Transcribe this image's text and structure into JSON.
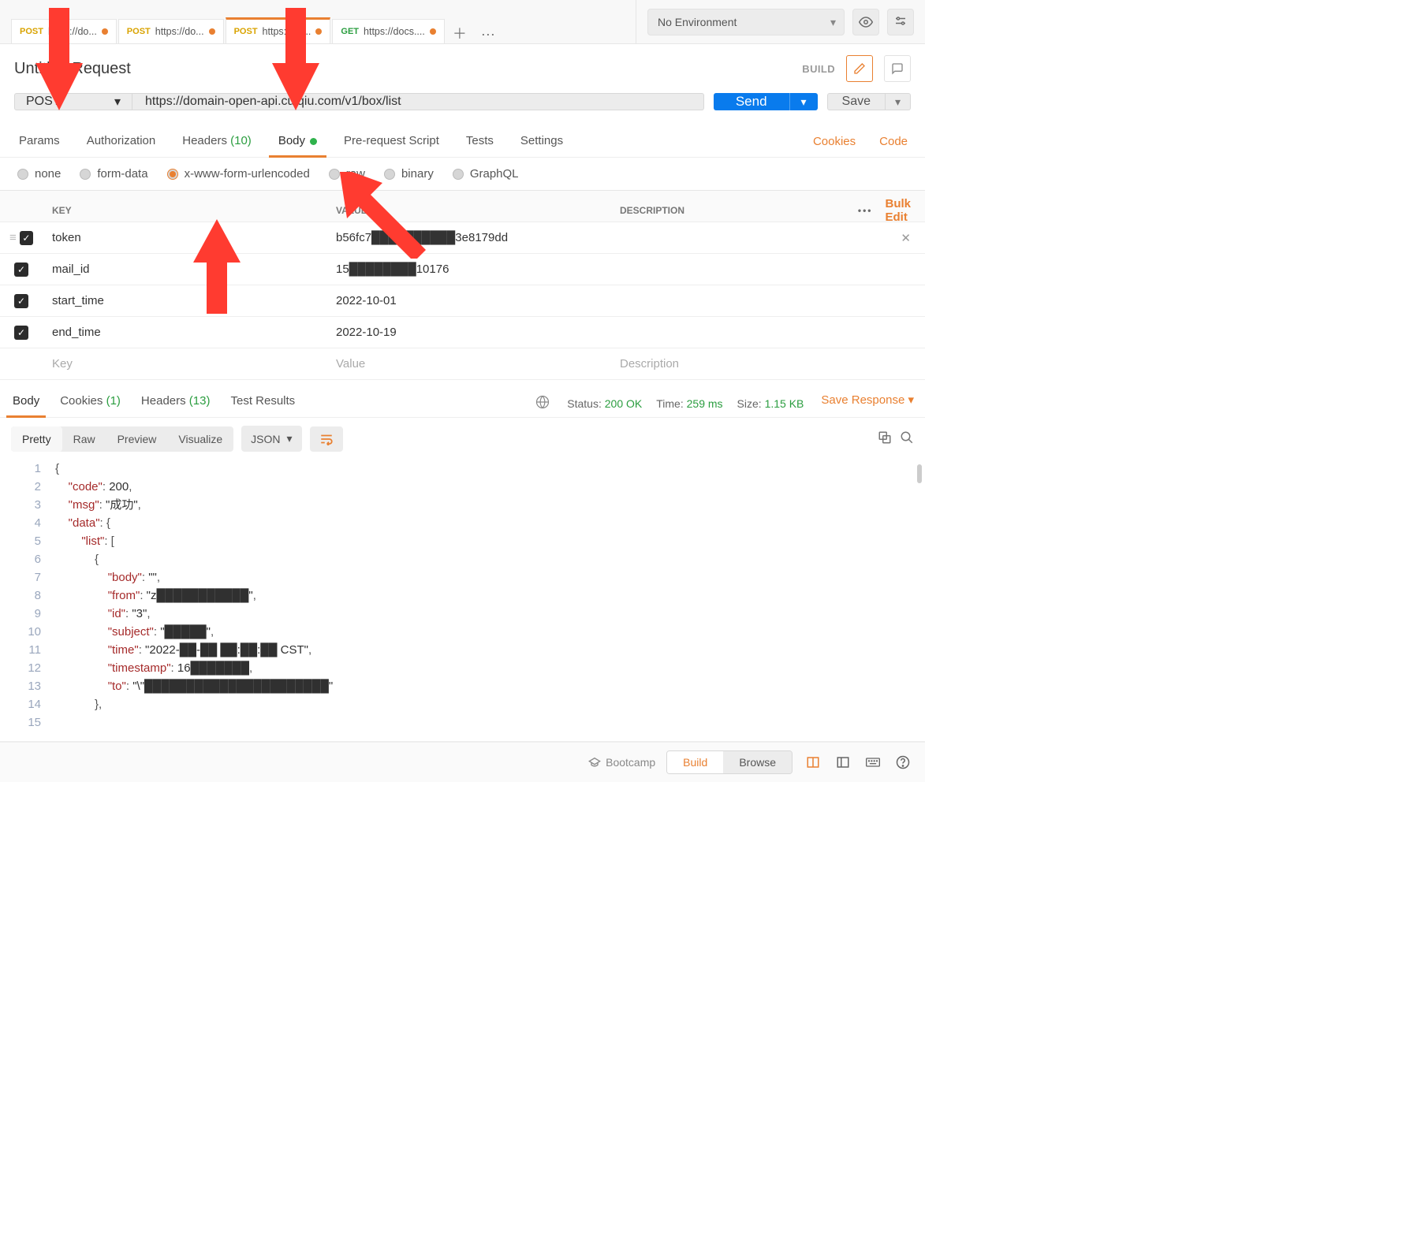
{
  "tabs": [
    {
      "method": "POST",
      "cls": "post",
      "title": "https://do...",
      "active": false
    },
    {
      "method": "POST",
      "cls": "post",
      "title": "https://do...",
      "active": false
    },
    {
      "method": "POST",
      "cls": "post",
      "title": "https://do...",
      "active": true
    },
    {
      "method": "GET",
      "cls": "get",
      "title": "https://docs....",
      "active": false
    }
  ],
  "env": {
    "label": "No Environment"
  },
  "request": {
    "title": "Untitled Request",
    "build_label": "BUILD",
    "method": "POST",
    "url": "https://domain-open-api.cuiqiu.com/v1/box/list",
    "send_label": "Send",
    "save_label": "Save"
  },
  "req_tabs": {
    "params": "Params",
    "auth": "Authorization",
    "headers": "Headers",
    "headers_count": "(10)",
    "body": "Body",
    "prereq": "Pre-request Script",
    "tests": "Tests",
    "settings": "Settings",
    "cookies_link": "Cookies",
    "code_link": "Code"
  },
  "body_types": {
    "none": "none",
    "formdata": "form-data",
    "urlenc": "x-www-form-urlencoded",
    "raw": "raw",
    "binary": "binary",
    "graphql": "GraphQL"
  },
  "kv": {
    "head_key": "KEY",
    "head_value": "VALUE",
    "head_desc": "DESCRIPTION",
    "bulk_edit": "Bulk Edit",
    "rows": [
      {
        "key": "token",
        "value": "b56fc7██████████3e8179dd"
      },
      {
        "key": "mail_id",
        "value": "15████████10176"
      },
      {
        "key": "start_time",
        "value": "2022-10-01"
      },
      {
        "key": "end_time",
        "value": "2022-10-19"
      }
    ],
    "ph_key": "Key",
    "ph_value": "Value",
    "ph_desc": "Description"
  },
  "response": {
    "tabs": {
      "body": "Body",
      "cookies": "Cookies",
      "cookies_count": "(1)",
      "headers": "Headers",
      "headers_count": "(13)",
      "tests": "Test Results"
    },
    "status_label": "Status:",
    "status_val": "200 OK",
    "time_label": "Time:",
    "time_val": "259 ms",
    "size_label": "Size:",
    "size_val": "1.15 KB",
    "save_resp": "Save Response",
    "view": {
      "pretty": "Pretty",
      "raw": "Raw",
      "preview": "Preview",
      "visualize": "Visualize",
      "format": "JSON"
    },
    "code_lines": [
      "{",
      "    \"code\": 200,",
      "    \"msg\": \"成功\",",
      "    \"data\": {",
      "        \"list\": [",
      "            {",
      "                \"body\": \"\",",
      "                \"from\": \"z███████████\",",
      "                \"id\": \"3\",",
      "                \"subject\": \"█████\",",
      "                \"time\": \"2022-██-██ ██:██:██ CST\",",
      "                \"timestamp\": 16███████,",
      "                \"to\": \"\\\"██████████████████████\"",
      "            },",
      ""
    ]
  },
  "footer": {
    "bootcamp": "Bootcamp",
    "build": "Build",
    "browse": "Browse"
  }
}
